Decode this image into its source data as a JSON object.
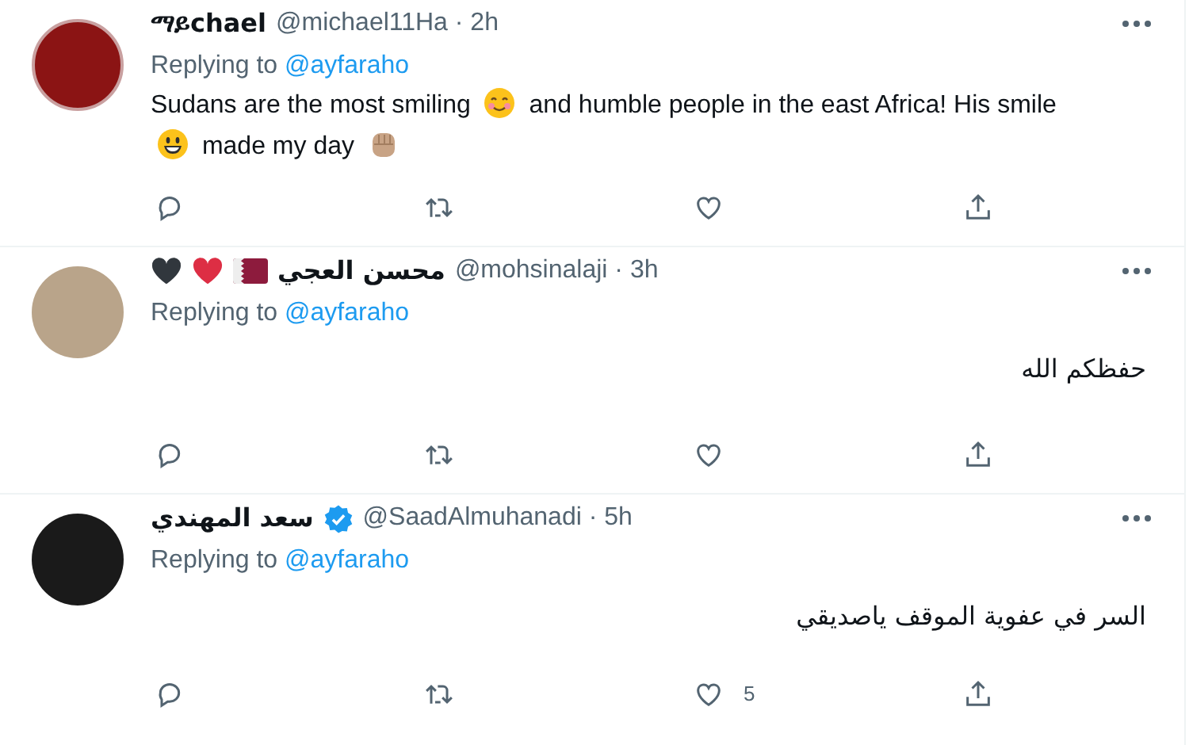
{
  "tweets": [
    {
      "avatar": {
        "kind": "emblem"
      },
      "name": "ማይchael",
      "verified": false,
      "handle": "@michael11Ha",
      "separator": "·",
      "time": "2h",
      "replying_label": "Replying to",
      "replying_to": "@ayfaraho",
      "rtl": false,
      "body": [
        {
          "kind": "text",
          "text": "Sudans are the most smiling"
        },
        {
          "kind": "blush-emoji"
        },
        {
          "kind": "text",
          "text": "and humble people in the east Africa! His smile"
        },
        {
          "kind": "grin-emoji"
        },
        {
          "kind": "text",
          "text": "made my day"
        },
        {
          "kind": "fist-emoji"
        }
      ]
    },
    {
      "avatar": {
        "kind": "photo"
      },
      "name": "محسن العجي",
      "name_icons": [
        {
          "kind": "black-heart"
        },
        {
          "kind": "red-heart"
        },
        {
          "kind": "flag"
        }
      ],
      "verified": false,
      "handle": "@mohsinalaji",
      "separator": "·",
      "time": "3h",
      "replying_label": "Replying to",
      "replying_to": "@ayfaraho",
      "rtl": true,
      "body": [
        {
          "kind": "text",
          "text": "حفظكم الله"
        }
      ]
    },
    {
      "avatar": {
        "kind": "photo-dark"
      },
      "name": "سعد المهندي",
      "verified": true,
      "handle": "@SaadAlmuhanadi",
      "separator": "·",
      "time": "5h",
      "replying_label": "Replying to",
      "replying_to": "@ayfaraho",
      "rtl": true,
      "body": [
        {
          "kind": "text",
          "text": "السر في عفوية الموقف ياصديقي"
        }
      ],
      "like_count": "5"
    }
  ]
}
